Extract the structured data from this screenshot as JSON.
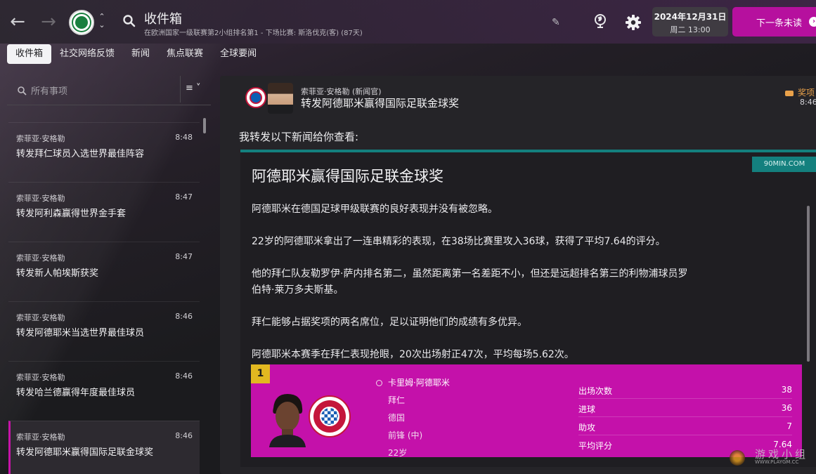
{
  "topbar": {
    "title": "收件箱",
    "subtitle": "在欧洲国家一级联赛第2小组排名第1 - 下场比赛: 斯洛伐克(客) (87天)",
    "date": "2024年12月31日",
    "weekday_time": "周二 13:00",
    "next_button": "下一条未读",
    "icons": [
      "back-icon",
      "forward-icon",
      "club-crest-icon",
      "updown-icon",
      "search-icon",
      "pencil-icon",
      "globe-icon",
      "gear-icon",
      "chevron-right-icon"
    ]
  },
  "tabs": [
    {
      "label": "收件箱",
      "active": true
    },
    {
      "label": "社交网络反馈"
    },
    {
      "label": "新闻"
    },
    {
      "label": "焦点联赛"
    },
    {
      "label": "全球要闻"
    }
  ],
  "search": {
    "placeholder": "所有事项"
  },
  "messages": [
    {
      "from": "索菲亚·安格勒",
      "time": "8:48",
      "subject": "转发拜仁球员入选世界最佳阵容"
    },
    {
      "from": "索菲亚·安格勒",
      "time": "8:47",
      "subject": "转发阿利森赢得世界金手套"
    },
    {
      "from": "索菲亚·安格勒",
      "time": "8:47",
      "subject": "转发新人帕埃斯获奖"
    },
    {
      "from": "索菲亚·安格勒",
      "time": "8:46",
      "subject": "转发阿德耶米当选世界最佳球员"
    },
    {
      "from": "索菲亚·安格勒",
      "time": "8:46",
      "subject": "转发哈兰德赢得年度最佳球员"
    },
    {
      "from": "索菲亚·安格勒",
      "time": "8:46",
      "subject": "转发阿德耶米赢得国际足联金球奖",
      "active": true
    }
  ],
  "reader": {
    "from": "索菲亚·安格勒 (新闻官)",
    "subject": "转发阿德耶米赢得国际足联金球奖",
    "tag": "奖项",
    "time": "8:46",
    "intro": "我转发以下新闻给你查看:"
  },
  "article": {
    "source": "90MIN.COM",
    "title": "阿德耶米赢得国际足联金球奖",
    "paragraphs": [
      "阿德耶米在德国足球甲级联赛的良好表现并没有被忽略。",
      "22岁的阿德耶米拿出了一连串精彩的表现，在38场比赛里攻入36球，获得了平均7.64的评分。",
      "他的拜仁队友勒罗伊·萨内排名第二，虽然距离第一名差距不小，但还是远超排名第三的利物浦球员罗伯特·莱万多夫斯基。",
      "拜仁能够占据奖项的两名席位，足以证明他们的成绩有多优异。",
      "阿德耶米本赛季在拜仁表现抢眼，20次出场射正47次，平均每场5.62次。"
    ]
  },
  "player_card": {
    "rank": "1",
    "name": "卡里姆·阿德耶米",
    "club": "拜仁",
    "nation": "德国",
    "position": "前锋 (中)",
    "age": "22岁",
    "stats": [
      {
        "label": "出场次数",
        "value": "38"
      },
      {
        "label": "进球",
        "value": "36"
      },
      {
        "label": "助攻",
        "value": "7"
      },
      {
        "label": "平均评分",
        "value": "7.64"
      }
    ]
  },
  "watermark": {
    "text": "游戏小组",
    "url": "WWW.PLAYGM.CC"
  },
  "colors": {
    "accent": "#c411aa",
    "teal": "#14807e",
    "rank": "#e2b820",
    "tag": "#e9a14a"
  }
}
